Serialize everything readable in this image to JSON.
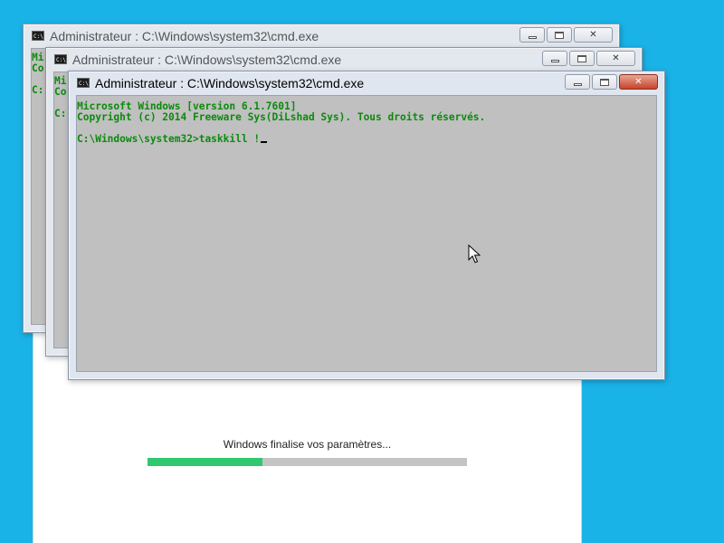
{
  "colors": {
    "desktop": "#1ab3e8",
    "console_bg": "#c0c0c0",
    "console_text": "#0c8a0c",
    "progress_fill": "#2fc86e",
    "progress_track": "#c4c4c4"
  },
  "setup": {
    "status": "Windows finalise vos paramètres...",
    "progress_percent": 36
  },
  "windows": {
    "back": {
      "title": "Administrateur : C:\\Windows\\system32\\cmd.exe",
      "lines": [
        "Mi",
        "Co",
        "",
        "C:"
      ]
    },
    "middle": {
      "title": "Administrateur : C:\\Windows\\system32\\cmd.exe",
      "lines": [
        "Mi",
        "Co",
        "",
        "C:"
      ]
    },
    "front": {
      "title": "Administrateur : C:\\Windows\\system32\\cmd.exe",
      "lines": [
        "Microsoft Windows [version 6.1.7601]",
        "Copyright (c) 2014 Freeware Sys(DiLshad Sys). Tous droits réservés.",
        "",
        "C:\\Windows\\system32>taskkill !"
      ]
    }
  },
  "buttons": {
    "minimize": "",
    "maximize": "",
    "close": "✕"
  },
  "icons": {
    "window_icon": "cmd-icon",
    "pointer": "arrow-cursor-icon"
  },
  "icon_text": "C:\\"
}
